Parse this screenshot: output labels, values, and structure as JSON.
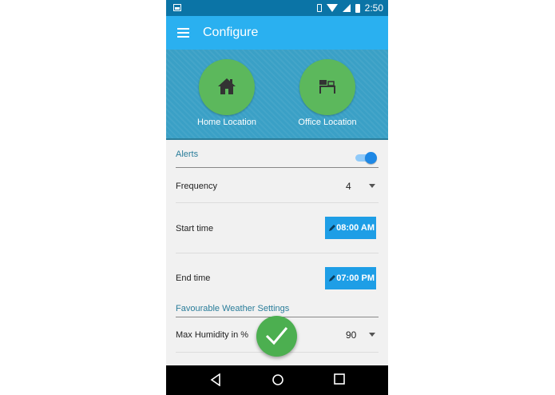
{
  "status_bar": {
    "time": "2:50",
    "icons": [
      "image-icon",
      "vibrate-icon",
      "wifi-icon",
      "signal-icon",
      "battery-icon"
    ]
  },
  "app_bar": {
    "title": "Configure",
    "menu_icon": "hamburger-menu-icon"
  },
  "locations": [
    {
      "label": "Home Location",
      "icon": "home-icon"
    },
    {
      "label": "Office Location",
      "icon": "desk-icon"
    }
  ],
  "alerts": {
    "header": "Alerts",
    "enabled": true
  },
  "frequency": {
    "label": "Frequency",
    "value": "4"
  },
  "start_time": {
    "label": "Start time",
    "value": "08:00 AM"
  },
  "end_time": {
    "label": "End time",
    "value": "07:00 PM"
  },
  "weather": {
    "header": "Favourable Weather Settings"
  },
  "max_humidity": {
    "label": "Max Humidity in %",
    "value": "90"
  },
  "colors": {
    "status_bar": "#0b74a6",
    "app_bar": "#2ab0f0",
    "hero": "#3aa0c6",
    "accent_green": "#5cb85c",
    "time_button": "#1e9ee6",
    "section_header": "#2a7d9a"
  },
  "fab": {
    "icon": "checkmark-icon"
  },
  "nav_bar": {
    "buttons": [
      "back-icon",
      "home-circle-icon",
      "recents-square-icon"
    ]
  }
}
